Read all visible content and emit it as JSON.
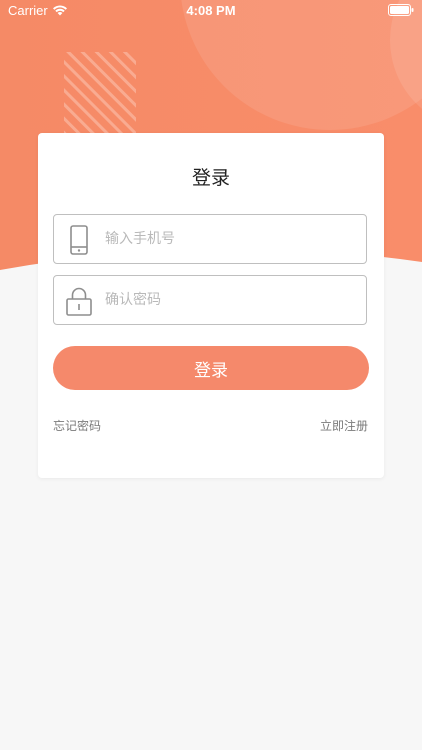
{
  "status_bar": {
    "carrier": "Carrier",
    "time": "4:08 PM"
  },
  "colors": {
    "accent": "#f5896b",
    "hero_light": "#fba888",
    "hero_dark": "#f58a66"
  },
  "login": {
    "title": "登录",
    "phone_placeholder": "输入手机号",
    "password_placeholder": "确认密码",
    "submit_label": "登录",
    "forgot_label": "忘记密码",
    "register_label": "立即注册"
  },
  "icons": {
    "phone": "phone-icon",
    "lock": "lock-icon"
  }
}
